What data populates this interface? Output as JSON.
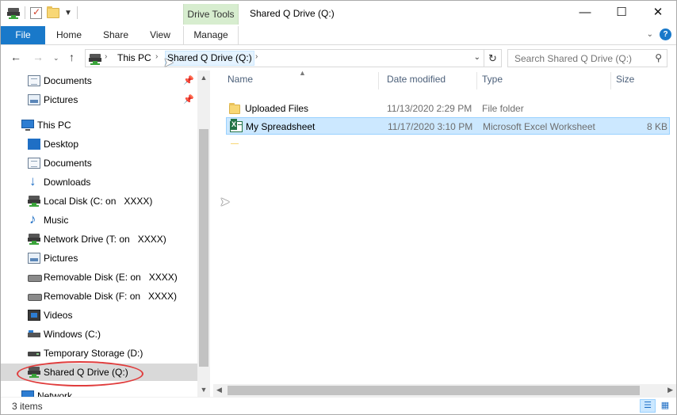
{
  "titlebar": {
    "context_tab": "Drive Tools",
    "title": "Shared Q Drive (Q:)",
    "minimize": "—",
    "maximize": "☐",
    "close": "✕"
  },
  "ribbon": {
    "tabs": [
      "File",
      "Home",
      "Share",
      "View",
      "Manage"
    ],
    "help": "?"
  },
  "address": {
    "crumbs": [
      "This PC",
      "Shared Q Drive (Q:)"
    ],
    "search_placeholder": "Search Shared Q Drive (Q:)"
  },
  "nav": {
    "items": [
      {
        "label": "Documents",
        "icon": "documents-icon",
        "pinned": true
      },
      {
        "label": "Pictures",
        "icon": "pictures-icon",
        "pinned": true
      },
      {
        "label": "This PC",
        "icon": "this-pc-icon"
      },
      {
        "label": "Desktop",
        "icon": "desktop-icon"
      },
      {
        "label": "Documents",
        "icon": "documents-icon"
      },
      {
        "label": "Downloads",
        "icon": "downloads-icon"
      },
      {
        "label": "Local Disk (C: on   XXXX)",
        "icon": "network-drive-icon"
      },
      {
        "label": "Music",
        "icon": "music-icon"
      },
      {
        "label": "Network Drive (T: on   XXXX)",
        "icon": "network-drive-icon"
      },
      {
        "label": "Pictures",
        "icon": "pictures-icon"
      },
      {
        "label": "Removable Disk (E: on   XXXX)",
        "icon": "removable-disk-icon"
      },
      {
        "label": "Removable Disk (F: on   XXXX)",
        "icon": "removable-disk-icon"
      },
      {
        "label": "Videos",
        "icon": "videos-icon"
      },
      {
        "label": "Windows (C:)",
        "icon": "windows-drive-icon"
      },
      {
        "label": "Temporary Storage (D:)",
        "icon": "disk-icon"
      },
      {
        "label": "Shared Q Drive (Q:)",
        "icon": "network-drive-icon",
        "selected": true
      },
      {
        "label": "Network",
        "icon": "network-icon"
      }
    ]
  },
  "columns": {
    "name": "Name",
    "date": "Date modified",
    "type": "Type",
    "size": "Size"
  },
  "files": [
    {
      "name": "Uploaded Files",
      "date": "11/13/2020 2:29 PM",
      "type": "File folder",
      "size": "",
      "icon": "folder-icon"
    },
    {
      "name": "My Spreadsheet",
      "date": "11/17/2020 3:10 PM",
      "type": "Microsoft Excel Worksheet",
      "size": "8 KB",
      "icon": "excel-icon",
      "selected": true
    }
  ],
  "status": {
    "count": "3 items"
  },
  "colors": {
    "accent": "#1979ca",
    "selection": "#cce8ff",
    "context_tab": "#d7edcf",
    "annotation": "#e03c3c"
  }
}
